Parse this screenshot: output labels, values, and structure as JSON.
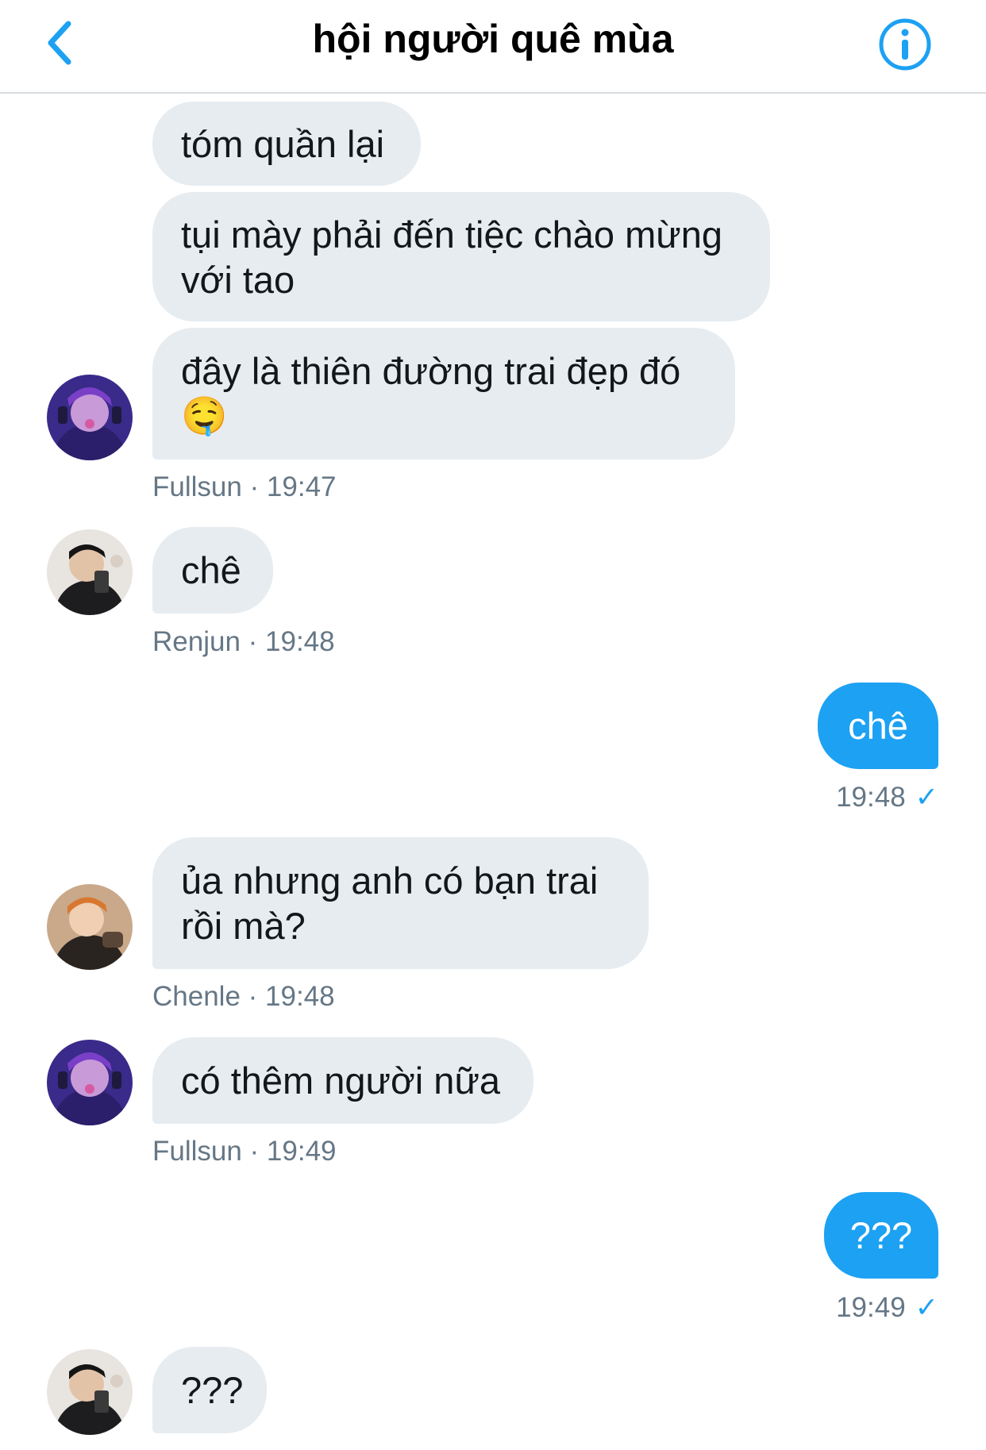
{
  "header": {
    "title": "hội người quê mùa",
    "back_icon": "chevron-left-icon",
    "info_icon": "info-icon",
    "accent": "#1da1f2"
  },
  "messages": {
    "m1": "tóm quần lại",
    "m2_line1": "tụi mày phải đến tiệc chào mừng",
    "m2_line2": "với tao",
    "m3_line1": "đây là thiên đường trai đẹp đó",
    "m3_emoji": "🤤",
    "meta1": "Fullsun · 19:47",
    "m4": "chê",
    "meta2": "Renjun · 19:48",
    "m5": "chê",
    "meta3": "19:48",
    "m6_line1": "ủa nhưng anh có bạn trai",
    "m6_line2": "rồi mà?",
    "meta4": "Chenle · 19:48",
    "m7": "có thêm người nữa",
    "meta5": "Fullsun · 19:49",
    "m8": "???",
    "meta6": "19:49",
    "m9": "???"
  },
  "colors": {
    "incoming_bubble": "#e6ecf0",
    "outgoing_bubble": "#1da1f2",
    "meta_text": "#657786"
  }
}
